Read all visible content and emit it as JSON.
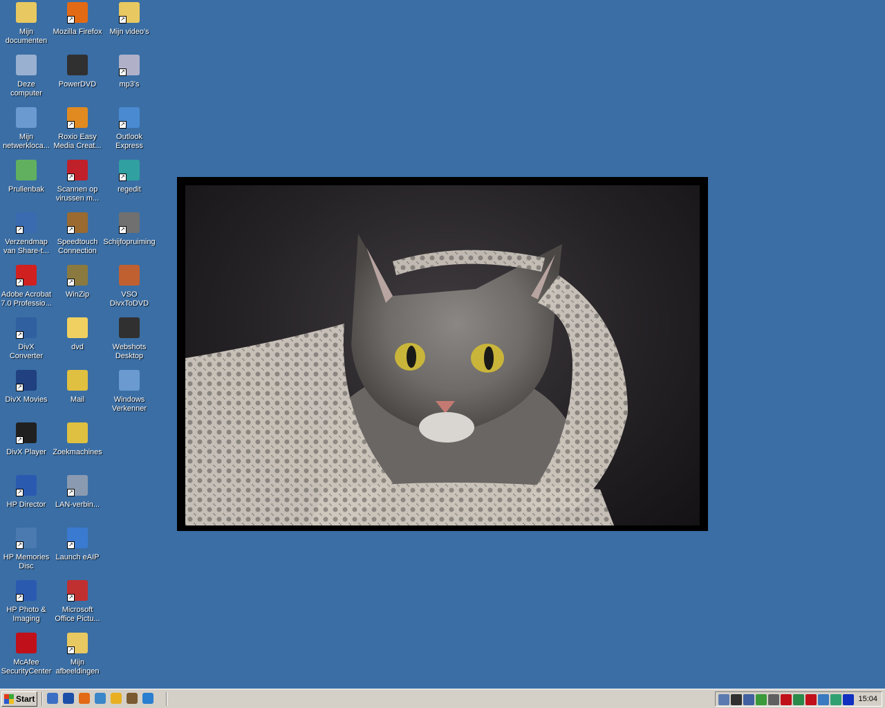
{
  "desktop": {
    "background_color": "#3a6ea5",
    "icons": [
      {
        "label": "Mijn\ndocumenten",
        "icon": "my-documents-icon",
        "shortcut": false
      },
      {
        "label": "Deze\ncomputer",
        "icon": "my-computer-icon",
        "shortcut": false
      },
      {
        "label": "Mijn\nnetwerkloca...",
        "icon": "network-places-icon",
        "shortcut": false
      },
      {
        "label": "Prullenbak",
        "icon": "recycle-bin-icon",
        "shortcut": false
      },
      {
        "label": "Verzendmap\nvan Share-t...",
        "icon": "hp-share-folder-icon",
        "shortcut": true
      },
      {
        "label": "Adobe Acrobat\n7.0 Professio...",
        "icon": "adobe-acrobat-icon",
        "shortcut": true
      },
      {
        "label": "DivX\nConverter",
        "icon": "divx-converter-icon",
        "shortcut": true
      },
      {
        "label": "DivX Movies",
        "icon": "divx-movies-icon",
        "shortcut": true
      },
      {
        "label": "DivX Player",
        "icon": "divx-player-icon",
        "shortcut": true
      },
      {
        "label": "HP Director",
        "icon": "hp-director-icon",
        "shortcut": true
      },
      {
        "label": "HP Memories\nDisc",
        "icon": "hp-memories-disc-icon",
        "shortcut": true
      },
      {
        "label": "HP Photo &\nImaging",
        "icon": "hp-photo-imaging-icon",
        "shortcut": true
      },
      {
        "label": "McAfee\nSecurityCenter",
        "icon": "mcafee-icon",
        "shortcut": false
      },
      {
        "label": "Mozilla Firefox",
        "icon": "firefox-icon",
        "shortcut": true
      },
      {
        "label": "PowerDVD",
        "icon": "powerdvd-icon",
        "shortcut": false
      },
      {
        "label": "Roxio Easy\nMedia Creat...",
        "icon": "roxio-icon",
        "shortcut": true
      },
      {
        "label": "Scannen op\nvirussen m...",
        "icon": "virus-scan-icon",
        "shortcut": true
      },
      {
        "label": "Speedtouch\nConnection",
        "icon": "speedtouch-icon",
        "shortcut": true
      },
      {
        "label": "WinZip",
        "icon": "winzip-icon",
        "shortcut": true
      },
      {
        "label": "dvd",
        "icon": "folder-icon",
        "shortcut": false
      },
      {
        "label": "Mail",
        "icon": "mail-icon",
        "shortcut": false
      },
      {
        "label": "Zoekmachines",
        "icon": "search-engines-icon",
        "shortcut": false
      },
      {
        "label": "LAN-verbin...",
        "icon": "lan-connection-icon",
        "shortcut": true
      },
      {
        "label": "Launch eAIP",
        "icon": "eaip-plane-icon",
        "shortcut": true
      },
      {
        "label": "Microsoft\nOffice Pictu...",
        "icon": "office-picture-icon",
        "shortcut": true
      },
      {
        "label": "Mijn\nafbeeldingen",
        "icon": "my-pictures-icon",
        "shortcut": true
      },
      {
        "label": "Mijn video's",
        "icon": "my-videos-icon",
        "shortcut": true
      },
      {
        "label": "mp3's",
        "icon": "mp3-folder-icon",
        "shortcut": true
      },
      {
        "label": "Outlook\nExpress",
        "icon": "outlook-express-icon",
        "shortcut": true
      },
      {
        "label": "regedit",
        "icon": "regedit-icon",
        "shortcut": true
      },
      {
        "label": "Schijfopruiming",
        "icon": "disk-cleanup-icon",
        "shortcut": true
      },
      {
        "label": "VSO\nDivxToDVD",
        "icon": "vso-divxtodvd-icon",
        "shortcut": false
      },
      {
        "label": "Webshots\nDesktop",
        "icon": "webshots-icon",
        "shortcut": false
      },
      {
        "label": "Windows\nVerkenner",
        "icon": "windows-explorer-icon",
        "shortcut": false
      }
    ]
  },
  "wallpaper": {
    "subject": "cat-photo"
  },
  "taskbar": {
    "start_label": "Start",
    "quick_launch": [
      {
        "icon": "show-desktop-icon",
        "color": "#3b6fc4"
      },
      {
        "icon": "media-player-icon",
        "color": "#1c4fa8"
      },
      {
        "icon": "firefox-icon",
        "color": "#e36a14"
      },
      {
        "icon": "outlook-express-icon",
        "color": "#3a86c8"
      },
      {
        "icon": "clock-app-icon",
        "color": "#e8b020"
      },
      {
        "icon": "network-icon",
        "color": "#7a5a30"
      },
      {
        "icon": "internet-explorer-icon",
        "color": "#2a7fd0"
      }
    ],
    "tray_icons": [
      {
        "icon": "display-icon",
        "color": "#5a7ab0"
      },
      {
        "icon": "camera-icon",
        "color": "#303030"
      },
      {
        "icon": "network-disabled-icon",
        "color": "#4060a0"
      },
      {
        "icon": "msn-icon",
        "color": "#3a9a3a"
      },
      {
        "icon": "security-icon",
        "color": "#606060"
      },
      {
        "icon": "mcafee-icon",
        "color": "#c0101a"
      },
      {
        "icon": "speedtouch-icon",
        "color": "#2a8a4a"
      },
      {
        "icon": "ati-icon",
        "color": "#c0101a"
      },
      {
        "icon": "help-icon",
        "color": "#3a7ac0"
      },
      {
        "icon": "connection-icon",
        "color": "#30a070"
      },
      {
        "icon": "player-icon",
        "color": "#1030c0"
      }
    ],
    "clock": "15:04"
  }
}
